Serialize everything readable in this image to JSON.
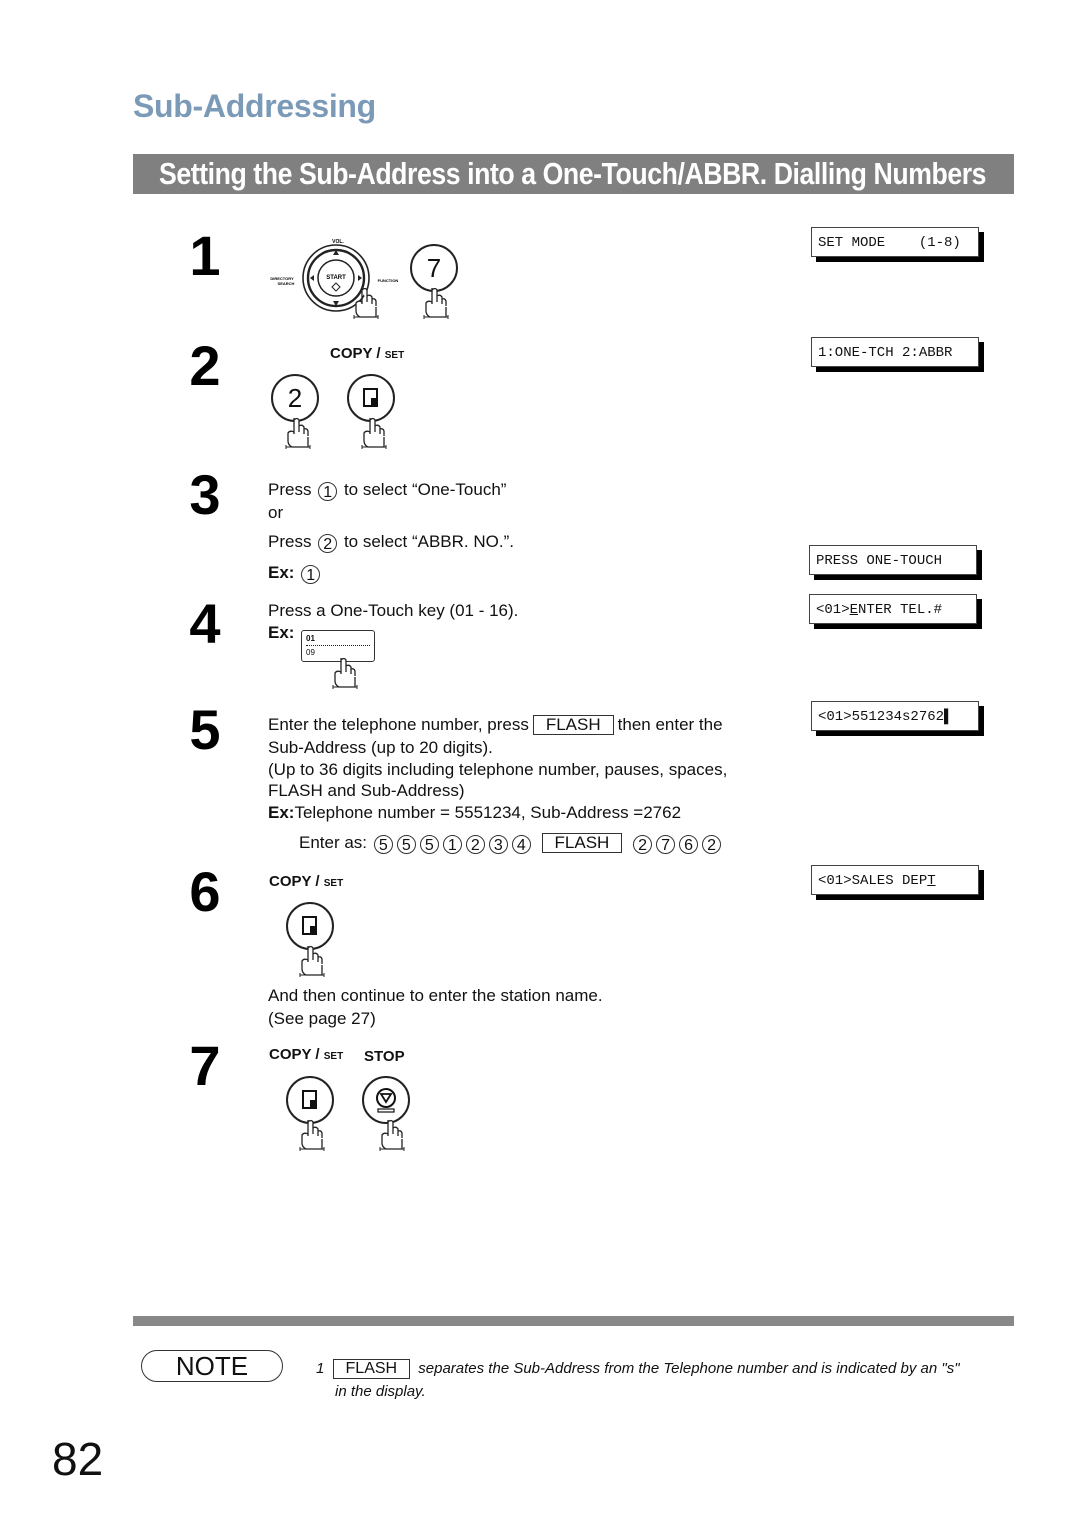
{
  "header": {
    "section_title": "Sub-Addressing",
    "banner_title": "Setting the Sub-Address into a One-Touch/ABBR. Dialling Numbers"
  },
  "keys": {
    "copy": "COPY /",
    "set": "SET",
    "stop": "STOP",
    "start": "START",
    "vol": "VOL.",
    "directory": "DIRECTORY",
    "search": "SEARCH",
    "function": "FUNCTION",
    "flash": "FLASH"
  },
  "steps": [
    {
      "number": "1",
      "key_button": "7",
      "display": "SET MODE    (1-8)"
    },
    {
      "number": "2",
      "key_button": "2",
      "display": "1:ONE-TCH 2:ABBR"
    },
    {
      "number": "3",
      "line1_pre": "Press",
      "line1_key": "1",
      "line1_post": "to select “One-Touch”",
      "or": "or",
      "line2_pre": "Press",
      "line2_key": "2",
      "line2_post": "to select “ABBR. NO.”.",
      "ex_label": "Ex:",
      "ex_key": "1",
      "display": "PRESS ONE-TOUCH"
    },
    {
      "number": "4",
      "text": "Press a One-Touch key (01 - 16).",
      "ex_label": "Ex:",
      "onetouch_top": "01",
      "onetouch_bottom": "09",
      "display_prefix": "<01>",
      "display_cursor": "E",
      "display_rest": "NTER TEL.#"
    },
    {
      "number": "5",
      "line1_pre": "Enter the telephone number, press",
      "line1_post": "then enter the",
      "line2": "Sub-Address (up to 20 digits).",
      "line3": "(Up to 36 digits including telephone number, pauses, spaces,",
      "line4": "FLASH and Sub-Address)",
      "ex_label": "Ex:",
      "ex_text": "Telephone number = 5551234, Sub-Address =2762",
      "enter_as_label": "Enter as:",
      "enter_as_digits_before": [
        "5",
        "5",
        "5",
        "1",
        "2",
        "3",
        "4"
      ],
      "enter_as_digits_after": [
        "2",
        "7",
        "6",
        "2"
      ],
      "display": "<01>551234s2762",
      "display_cursor": "▌"
    },
    {
      "number": "6",
      "text1": "And then continue to enter the station name.",
      "text2": " (See page 27)",
      "display_prefix": "<01>SALES DEP",
      "display_cursor": "T"
    },
    {
      "number": "7"
    }
  ],
  "note": {
    "label": "NOTE",
    "item_number": "1",
    "key": "FLASH",
    "text1": "separates the Sub-Address from the Telephone number and is indicated by an \"s\"",
    "text2": "in the display."
  },
  "page_number": "82"
}
